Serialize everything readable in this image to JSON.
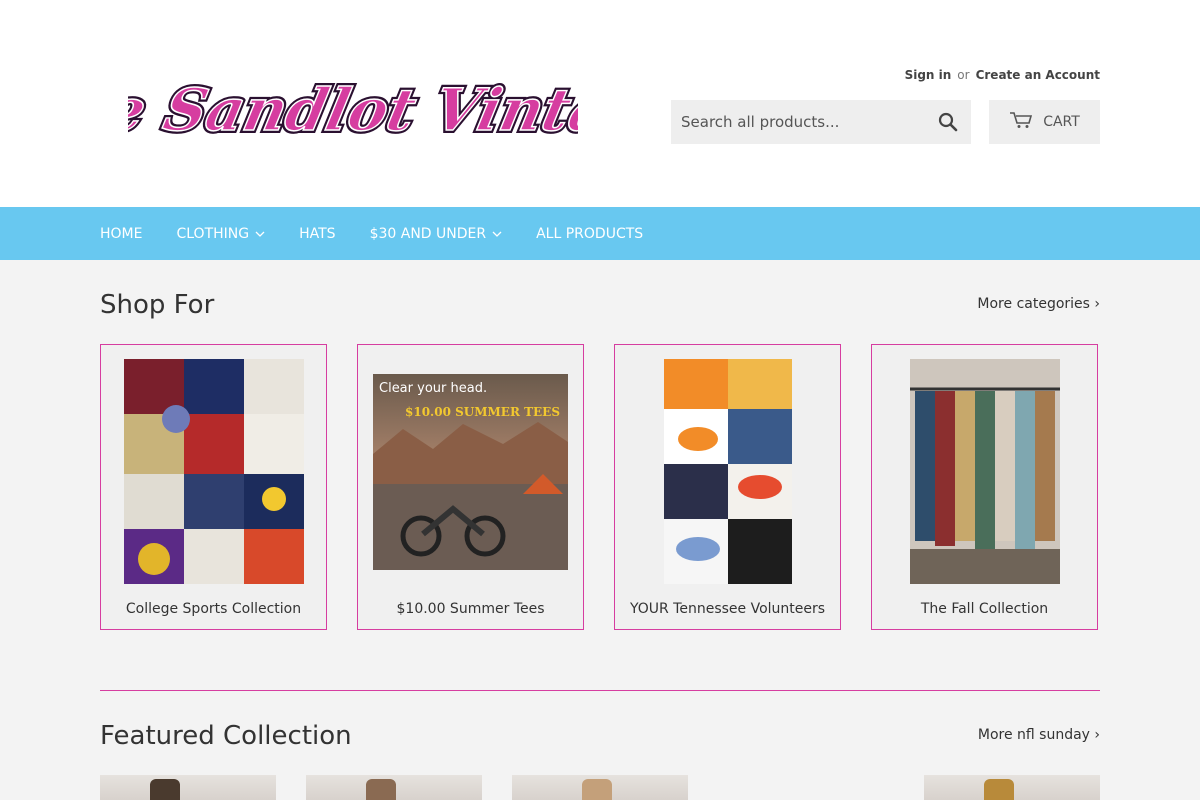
{
  "brand": {
    "name": "The Sandlot Vintage",
    "color": "#d63da0"
  },
  "account": {
    "sign_in": "Sign in",
    "or": "or",
    "create": "Create an Account"
  },
  "search": {
    "placeholder": "Search all products...",
    "icon": "search-icon"
  },
  "cart": {
    "label": "CART",
    "icon": "cart-icon"
  },
  "nav": {
    "items": [
      {
        "label": "HOME",
        "dropdown": false
      },
      {
        "label": "CLOTHING",
        "dropdown": true
      },
      {
        "label": "HATS",
        "dropdown": false
      },
      {
        "label": "$30 AND UNDER",
        "dropdown": true
      },
      {
        "label": "ALL PRODUCTS",
        "dropdown": false
      }
    ],
    "color": "#68c8f0"
  },
  "shop_for": {
    "title": "Shop For",
    "more_link": "More categories ›",
    "collections": [
      {
        "label": "College Sports Collection",
        "image_text": []
      },
      {
        "label": "$10.00 Summer Tees",
        "image_text": [
          "Clear your head.",
          "$10.00 SUMMER TEES"
        ]
      },
      {
        "label": "YOUR Tennessee Volunteers",
        "image_text": []
      },
      {
        "label": "The Fall Collection",
        "image_text": []
      }
    ]
  },
  "featured": {
    "title": "Featured Collection",
    "more_link": "More nfl sunday ›"
  }
}
